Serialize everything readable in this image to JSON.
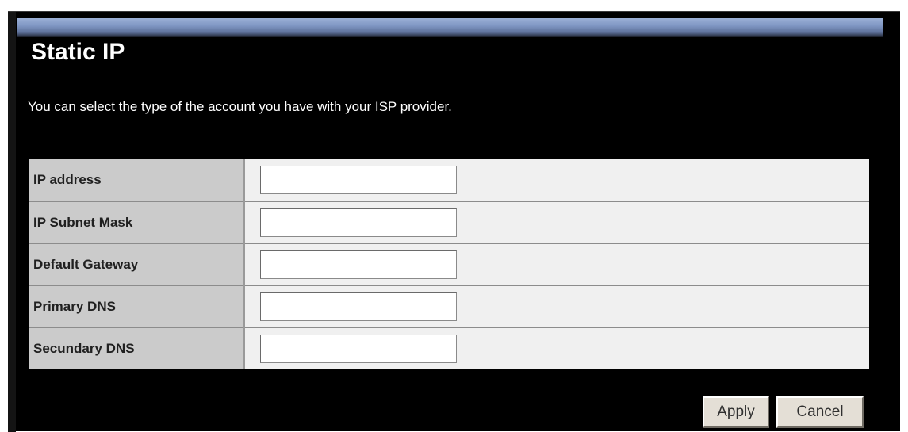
{
  "page": {
    "title": "Static IP",
    "description": "You can select the type of the account you have with your ISP provider."
  },
  "fields": [
    {
      "label": "IP address",
      "value": "",
      "placeholder": ""
    },
    {
      "label": "IP Subnet Mask",
      "value": "",
      "placeholder": ""
    },
    {
      "label": "Default Gateway",
      "value": "",
      "placeholder": ""
    },
    {
      "label": "Primary DNS",
      "value": "",
      "placeholder": ""
    },
    {
      "label": "Secundary DNS",
      "value": "",
      "placeholder": ""
    }
  ],
  "actions": {
    "apply_label": "Apply",
    "cancel_label": "Cancel"
  },
  "colors": {
    "background": "#000000",
    "title_bar": "#7f96c3",
    "label_cell": "#cbcbcb",
    "value_cell": "#f0f0f0",
    "button_face": "#e4dfd6"
  }
}
